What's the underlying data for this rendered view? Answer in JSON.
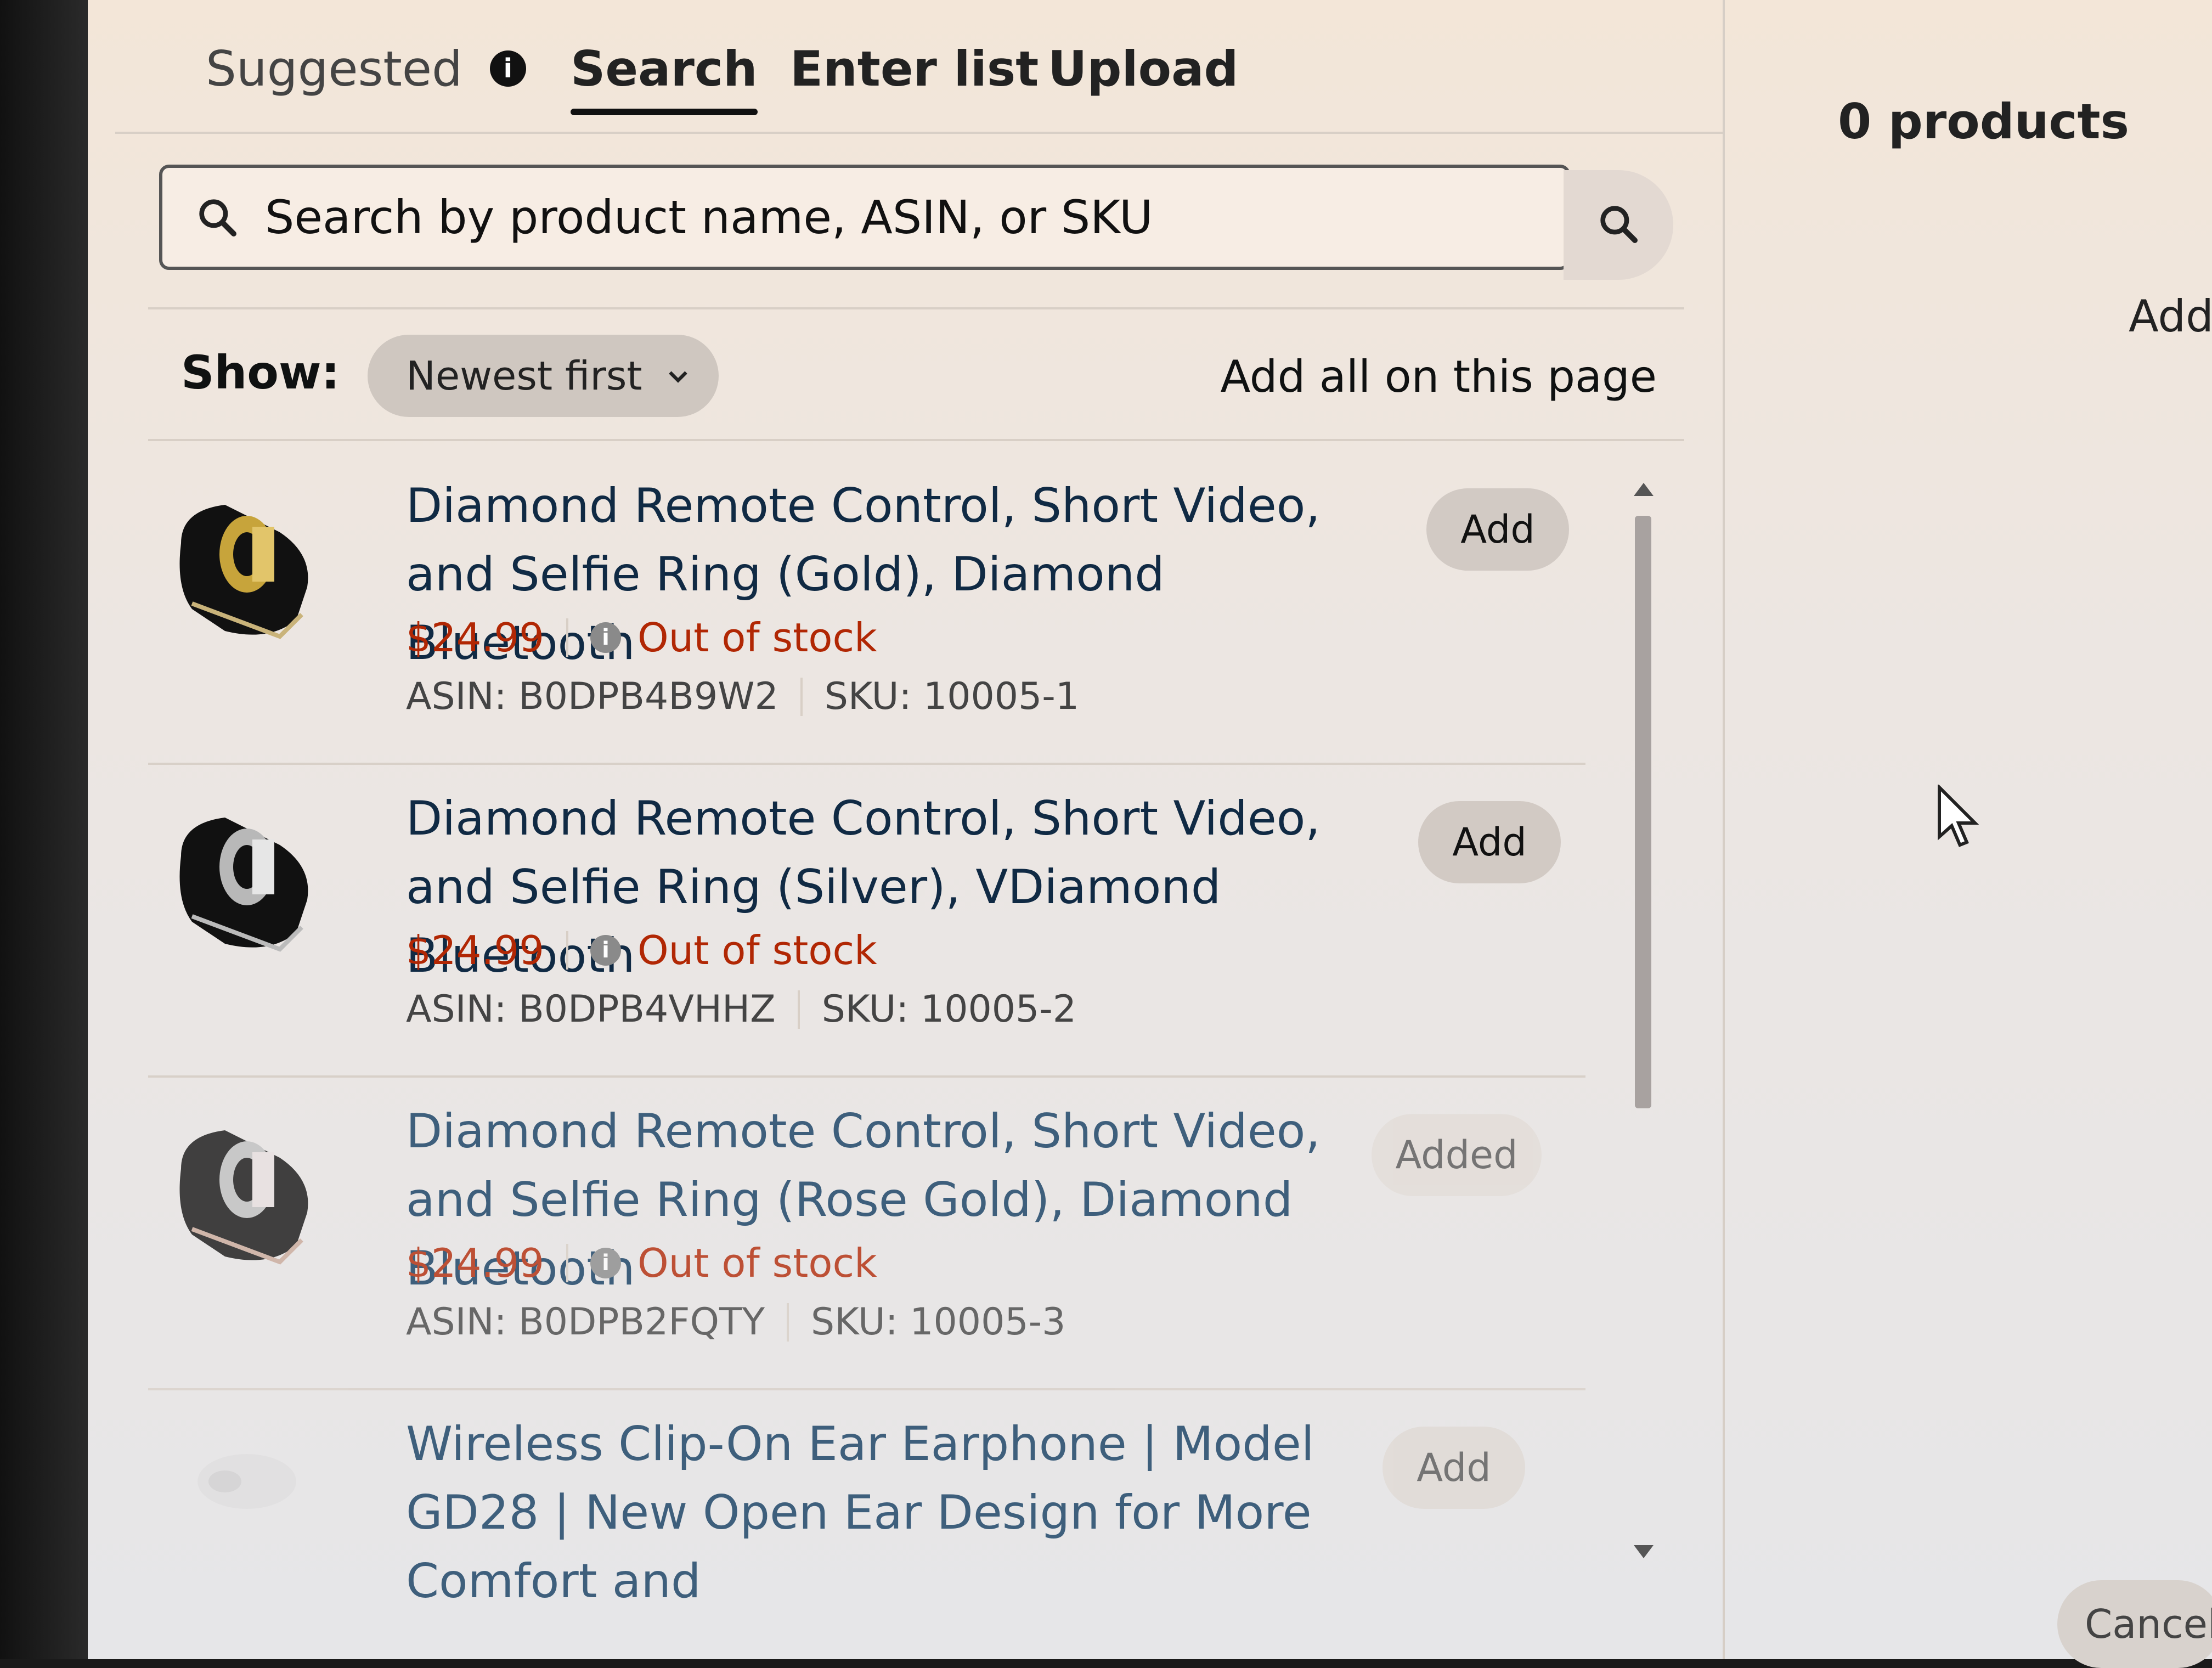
{
  "tabs": {
    "suggested": "Suggested",
    "suggested_info_icon": "info-icon",
    "search": "Search",
    "enter_list": "Enter list",
    "upload": "Upload",
    "active": "Search"
  },
  "search": {
    "placeholder": "Search by product name, ASIN, or SKU",
    "value": ""
  },
  "sort": {
    "label": "Show:",
    "selected": "Newest first"
  },
  "add_all_label": "Add all on this page",
  "products": [
    {
      "title": "Diamond Remote Control, Short Video, and Selfie Ring (Gold), Diamond Bluetooth",
      "price": "$24.99",
      "stock": "Out of stock",
      "asin": "ASIN: B0DPB4B9W2",
      "sku": "SKU: 10005-1",
      "action": "Add",
      "ring_color": "gold"
    },
    {
      "title": "Diamond Remote Control, Short Video, and Selfie Ring (Silver), VDiamond Bluetooth",
      "price": "$24.99",
      "stock": "Out of stock",
      "asin": "ASIN: B0DPB4VHHZ",
      "sku": "SKU: 10005-2",
      "action": "Add",
      "ring_color": "silver"
    },
    {
      "title": "Diamond Remote Control, Short Video, and Selfie Ring (Rose Gold), Diamond Bluetooth",
      "price": "$24.99",
      "stock": "Out of stock",
      "asin": "ASIN: B0DPB2FQTY",
      "sku": "SKU: 10005-3",
      "action": "Added",
      "ring_color": "silver"
    },
    {
      "title": "Wireless Clip-On Ear Earphone | Model GD28 | New Open Ear Design for More Comfort and",
      "action": "Add"
    }
  ],
  "right_panel": {
    "count": "0 products",
    "add_label": "Add",
    "cancel_label": "Cancel"
  },
  "colors": {
    "price": "#b12704",
    "link": "#0f3a5f",
    "button": "#d2cac4"
  }
}
